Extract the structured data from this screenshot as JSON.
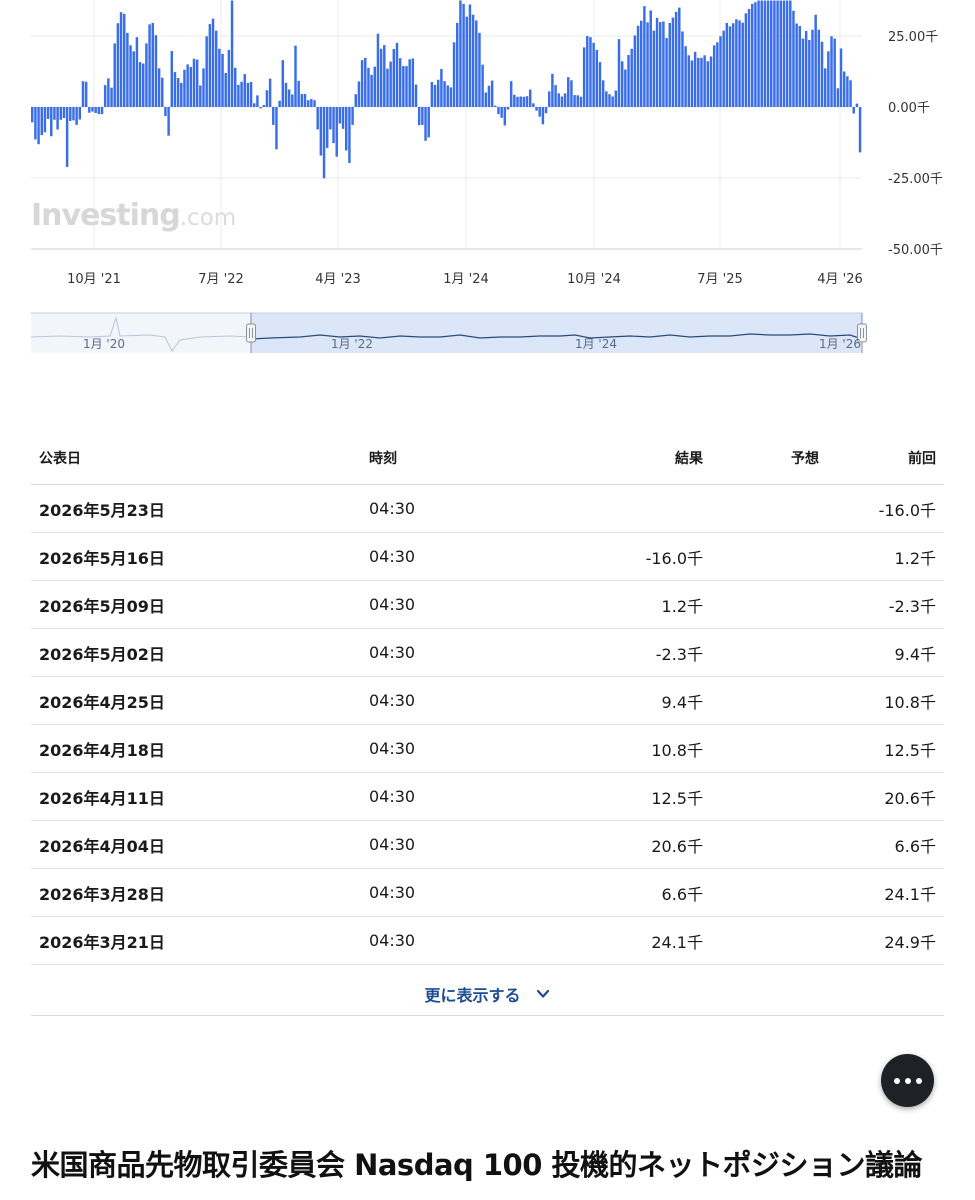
{
  "chart_data": {
    "type": "bar",
    "x_tick_labels": [
      "10月 '21",
      "7月 '22",
      "4月 '23",
      "1月 '24",
      "10月 '24",
      "7月 '25",
      "4月 '26"
    ],
    "y_tick_labels": [
      "25.00千",
      "0.00千",
      "-25.00千",
      "-50.00千"
    ],
    "y_ticks": [
      25,
      0,
      -25,
      -50
    ],
    "ylim": [
      -50,
      37.5
    ],
    "ylabel_unit": "千",
    "bar_color": "#3a6ee8",
    "grid": true,
    "series_values": [
      -5.4,
      -11.4,
      -13.1,
      -9.9,
      -8.9,
      -4.2,
      -10.3,
      -4.5,
      -7.9,
      -4.5,
      -3.9,
      -21.1,
      -4.9,
      -4.7,
      -6.3,
      -4.4,
      9.1,
      8.9,
      -2.0,
      -1.6,
      -2.1,
      -2.5,
      -2.5,
      7.7,
      10.1,
      6.8,
      22.4,
      29.5,
      33.4,
      32.8,
      26.1,
      21.7,
      19.6,
      24.6,
      15.8,
      15.3,
      22.4,
      29.1,
      29.6,
      25.3,
      13.6,
      10.3,
      -3.2,
      -10.1,
      19.7,
      12.3,
      10.2,
      8.5,
      13.1,
      15.0,
      14.1,
      17.0,
      16.7,
      7.6,
      13.6,
      24.9,
      29.2,
      31.1,
      26.9,
      20.5,
      18.7,
      12.0,
      20.1,
      37.5,
      13.8,
      7.8,
      8.9,
      11.6,
      8.5,
      8.8,
      1.3,
      4.1,
      -0.5,
      0.7,
      5.9,
      10.0,
      -6.3,
      -14.9,
      2.2,
      16.5,
      8.5,
      6.2,
      4.4,
      21.6,
      9.2,
      4.6,
      4.6,
      2.4,
      2.8,
      2.4,
      -7.9,
      -17.1,
      -25.1,
      -14.4,
      -7.9,
      -12.7,
      -17.5,
      -5.8,
      -7.7,
      -15.3,
      -19.7,
      -6.3,
      4.5,
      9.0,
      16.5,
      17.3,
      13.8,
      11.3,
      14.2,
      25.8,
      20.5,
      21.8,
      13.5,
      16.0,
      20.4,
      22.6,
      17.2,
      14.4,
      14.4,
      16.8,
      17.1,
      7.9,
      -6.4,
      -6.3,
      -11.9,
      -10.7,
      8.8,
      7.8,
      9.6,
      13.4,
      9.1,
      7.6,
      6.9,
      22.8,
      29.6,
      37.5,
      36.3,
      31.8,
      36.1,
      32.5,
      30.5,
      26.1,
      14.9,
      5.1,
      7.5,
      9.3,
      0.5,
      -2.5,
      -3.8,
      -6.5,
      -0.9,
      9.1,
      4.3,
      3.6,
      3.7,
      3.6,
      3.8,
      6.1,
      1.3,
      -1.3,
      -3.4,
      -6.1,
      -2.2,
      5.5,
      11.7,
      7.7,
      4.8,
      3.7,
      4.8,
      10.5,
      9.4,
      4.2,
      4.1,
      3.6,
      21.0,
      25.0,
      24.6,
      22.6,
      20.1,
      15.8,
      9.4,
      5.5,
      4.5,
      3.7,
      5.8,
      23.9,
      16.1,
      13.2,
      18.3,
      20.5,
      25.2,
      28.6,
      30.4,
      35.5,
      29.8,
      34.0,
      26.9,
      31.4,
      29.9,
      30.1,
      24.3,
      29.6,
      31.5,
      33.5,
      35.0,
      26.6,
      21.4,
      18.2,
      16.4,
      19.4,
      17.3,
      17.3,
      18.2,
      16.1,
      17.8,
      21.7,
      22.8,
      24.9,
      26.9,
      29.6,
      28.4,
      29.5,
      30.9,
      30.5,
      29.7,
      33.0,
      34.5,
      36.3,
      36.9,
      37.5,
      37.5,
      37.5,
      37.5,
      37.5,
      37.5,
      37.5,
      37.5,
      37.5,
      37.5,
      37.5,
      33.9,
      29.4,
      28.5,
      24.1,
      26.8,
      23.6,
      27.2,
      32.5,
      27.2,
      23.0,
      13.6,
      19.6,
      24.9,
      24.1,
      6.6,
      20.6,
      12.5,
      10.8,
      9.4,
      -2.3,
      1.2,
      -16.0
    ],
    "navigator": {
      "x_tick_labels": [
        "1月 '20",
        "1月 '22",
        "1月 '24",
        "1月 '26"
      ]
    },
    "watermark": {
      "main": "Investing",
      "suffix": ".com"
    }
  },
  "table": {
    "headers": {
      "date": "公表日",
      "time": "時刻",
      "actual": "結果",
      "forecast": "予想",
      "previous": "前回"
    },
    "rows": [
      {
        "date": "2026年5月23日",
        "time": "04:30",
        "actual": "",
        "forecast": "",
        "previous": "-16.0千"
      },
      {
        "date": "2026年5月16日",
        "time": "04:30",
        "actual": "-16.0千",
        "forecast": "",
        "previous": "1.2千"
      },
      {
        "date": "2026年5月09日",
        "time": "04:30",
        "actual": "1.2千",
        "forecast": "",
        "previous": "-2.3千"
      },
      {
        "date": "2026年5月02日",
        "time": "04:30",
        "actual": "-2.3千",
        "forecast": "",
        "previous": "9.4千"
      },
      {
        "date": "2026年4月25日",
        "time": "04:30",
        "actual": "9.4千",
        "forecast": "",
        "previous": "10.8千"
      },
      {
        "date": "2026年4月18日",
        "time": "04:30",
        "actual": "10.8千",
        "forecast": "",
        "previous": "12.5千"
      },
      {
        "date": "2026年4月11日",
        "time": "04:30",
        "actual": "12.5千",
        "forecast": "",
        "previous": "20.6千"
      },
      {
        "date": "2026年4月04日",
        "time": "04:30",
        "actual": "20.6千",
        "forecast": "",
        "previous": "6.6千"
      },
      {
        "date": "2026年3月28日",
        "time": "04:30",
        "actual": "6.6千",
        "forecast": "",
        "previous": "24.1千"
      },
      {
        "date": "2026年3月21日",
        "time": "04:30",
        "actual": "24.1千",
        "forecast": "",
        "previous": "24.9千"
      }
    ]
  },
  "show_more_label": "更に表示する",
  "page_title": "米国商品先物取引委員会 Nasdaq 100 投機的ネットポジション議論"
}
